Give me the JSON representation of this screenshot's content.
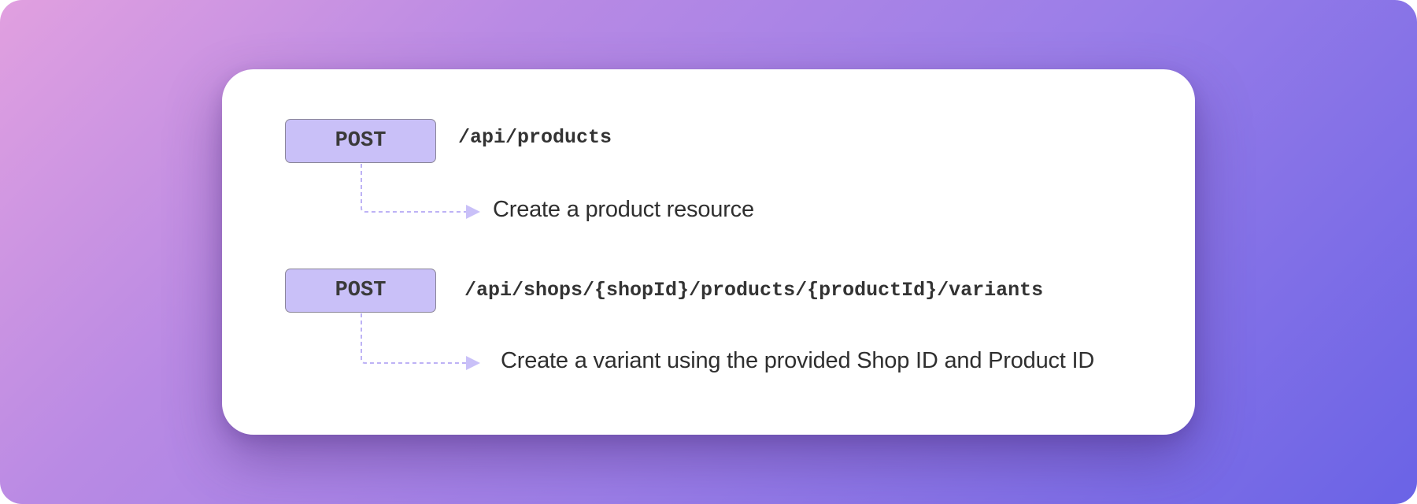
{
  "colors": {
    "background_start": "#e1a0e0",
    "background_end": "#6a63e6",
    "card": "#ffffff",
    "method_fill": "#c9c0f8",
    "method_border": "#8a8598",
    "connector": "#bdb2f5",
    "text": "#333333"
  },
  "endpoints": [
    {
      "method": "POST",
      "path": "/api/products",
      "description": "Create a product resource"
    },
    {
      "method": "POST",
      "path": "/api/shops/{shopId}/products/{productId}/variants",
      "description": "Create a variant using the provided Shop ID and Product ID"
    }
  ]
}
